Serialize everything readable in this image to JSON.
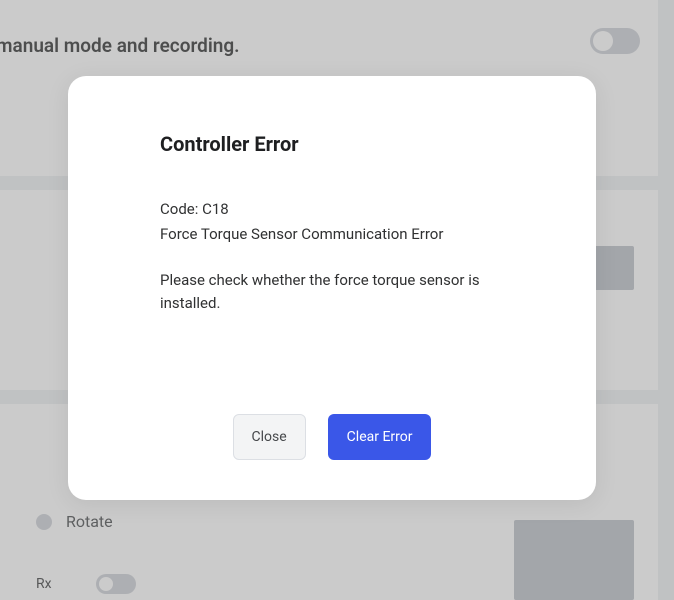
{
  "background": {
    "heading_text": "manual mode and recording.",
    "main_toggle_on": false,
    "rotate_option_label": "Rotate",
    "rx_label": "Rx",
    "rx_toggle_on": false
  },
  "modal": {
    "title": "Controller Error",
    "code_prefix": "Code: ",
    "code_value": "C18",
    "error_message": "Force Torque Sensor Communication Error",
    "description": "Please check whether the force torque sensor is installed.",
    "close_label": "Close",
    "clear_label": "Clear Error"
  }
}
